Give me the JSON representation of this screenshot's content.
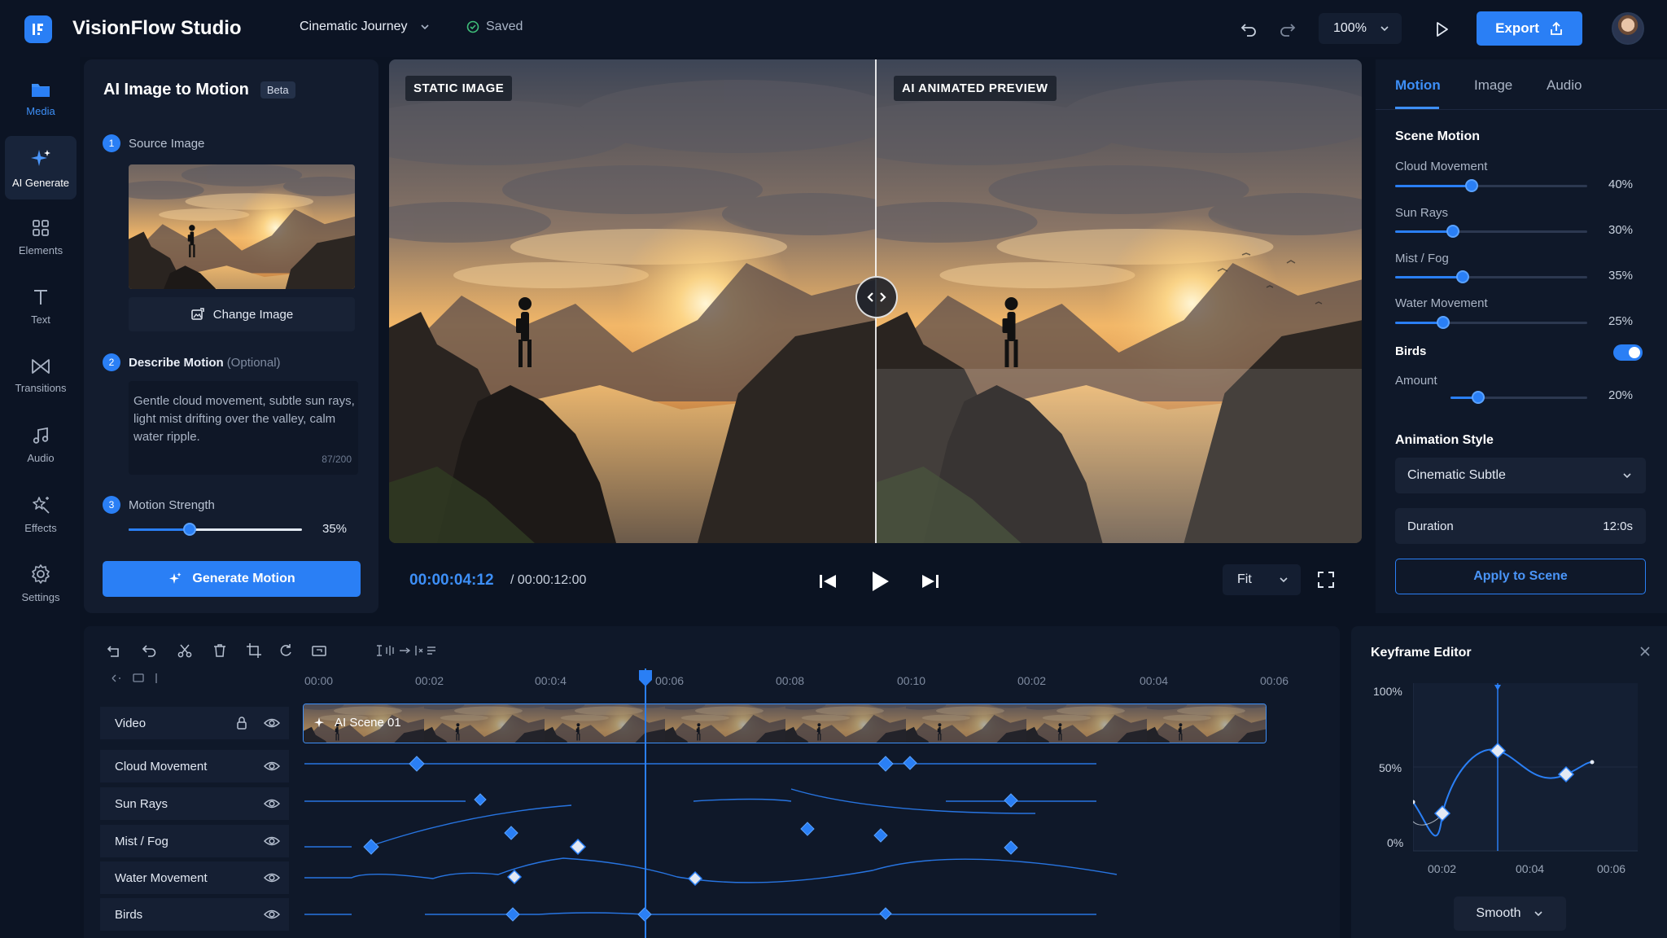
{
  "app": {
    "title": "VisionFlow Studio",
    "project_name": "Cinematic Journey",
    "save_status": "Saved",
    "zoom": "100%",
    "export_label": "Export"
  },
  "rail": {
    "items": [
      {
        "label": "Media",
        "icon": "folder-icon"
      },
      {
        "label": "AI Generate",
        "icon": "sparkle-icon"
      },
      {
        "label": "Elements",
        "icon": "grid-icon"
      },
      {
        "label": "Text",
        "icon": "text-icon"
      },
      {
        "label": "Transitions",
        "icon": "bowtie-icon"
      },
      {
        "label": "Audio",
        "icon": "music-icon"
      },
      {
        "label": "Effects",
        "icon": "effects-icon"
      },
      {
        "label": "Settings",
        "icon": "gear-icon"
      }
    ]
  },
  "left_panel": {
    "title": "AI Image to Motion",
    "badge": "Beta",
    "step1": {
      "num": "1",
      "label": "Source Image"
    },
    "change_image": "Change Image",
    "step2": {
      "num": "2",
      "label": "Describe Motion",
      "hint": "(Optional)"
    },
    "prompt": "Gentle cloud movement, subtle sun rays, light mist drifting over the valley, calm water ripple.",
    "counter": "87/200",
    "step3": {
      "num": "3",
      "label": "Motion Strength"
    },
    "strength_value": "35%",
    "strength_level": 0.35,
    "generate_label": "Generate Motion"
  },
  "preview": {
    "left_label": "STATIC IMAGE",
    "right_label": "AI ANIMATED PREVIEW",
    "current_time": "00:00:04:12",
    "total_time": "/ 00:00:12:00",
    "fit_label": "Fit"
  },
  "right_panel": {
    "tabs": [
      "Motion",
      "Image",
      "Audio"
    ],
    "scene_motion_heading": "Scene Motion",
    "sliders": [
      {
        "label": "Cloud Movement",
        "value": "40%",
        "level": 0.4
      },
      {
        "label": "Sun Rays",
        "value": "30%",
        "level": 0.3
      },
      {
        "label": "Mist / Fog",
        "value": "35%",
        "level": 0.35
      },
      {
        "label": "Water Movement",
        "value": "25%",
        "level": 0.25
      }
    ],
    "birds_label": "Birds",
    "birds_enabled": true,
    "amount_label": "Amount",
    "amount_value": "20%",
    "amount_level": 0.2,
    "animation_style_heading": "Animation Style",
    "animation_style": "Cinematic Subtle",
    "duration_label": "Duration",
    "duration_value": "12:0s",
    "apply_label": "Apply to Scene"
  },
  "timeline": {
    "ruler": [
      "00:00",
      "00:02",
      "00:0:4",
      "00:06",
      "00:08",
      "00:10",
      "00:02",
      "00:04",
      "00:06"
    ],
    "tracks": [
      "Video",
      "Cloud Movement",
      "Sun Rays",
      "Mist / Fog",
      "Water Movement",
      "Birds"
    ],
    "clip_label": "AI Scene 01"
  },
  "keyframe_editor": {
    "title": "Keyframe Editor",
    "y_labels": [
      "100%",
      "50%",
      "0%"
    ],
    "x_labels": [
      "00:02",
      "00:04",
      "00:06"
    ],
    "interpolation": "Smooth"
  },
  "colors": {
    "accent": "#2a7ff5",
    "background": "#0b1322",
    "panel": "#131c2e"
  }
}
